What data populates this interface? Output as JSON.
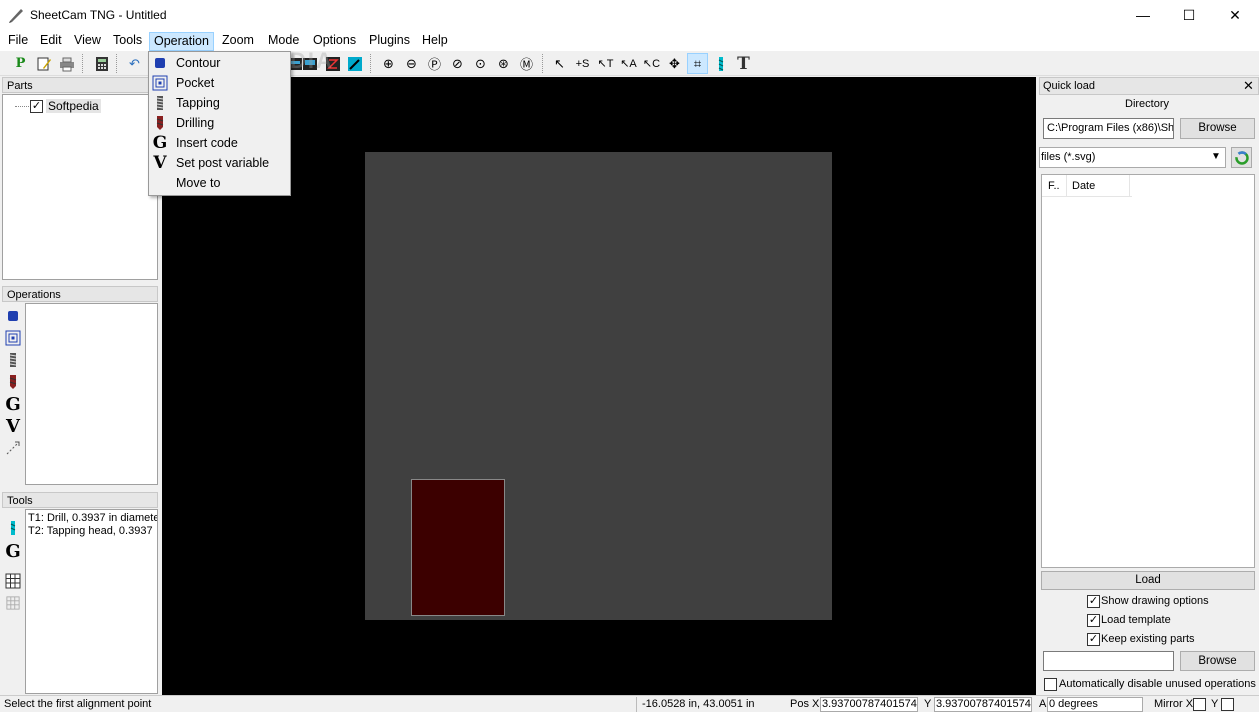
{
  "window": {
    "title": "SheetCam TNG - Untitled",
    "minimize": "—",
    "maximize": "☐",
    "close": "✕"
  },
  "menu": [
    "File",
    "Edit",
    "View",
    "Tools",
    "Operation",
    "Zoom",
    "Mode",
    "Options",
    "Plugins",
    "Help"
  ],
  "operation_menu": [
    {
      "label": "Contour",
      "icon": "contour-icon"
    },
    {
      "label": "Pocket",
      "icon": "pocket-icon"
    },
    {
      "label": "Tapping",
      "icon": "tapping-icon"
    },
    {
      "label": "Drilling",
      "icon": "drilling-icon"
    },
    {
      "label": "Insert code",
      "icon": "insert-code-icon",
      "glyph": "G"
    },
    {
      "label": "Set post variable",
      "icon": "post-variable-icon",
      "glyph": "V"
    },
    {
      "label": "Move to",
      "icon": ""
    }
  ],
  "watermark": "SOFTPEDIA",
  "parts": {
    "title": "Parts",
    "items": [
      {
        "label": "Softpedia",
        "checked": true
      }
    ]
  },
  "operations": {
    "title": "Operations",
    "glyph_g": "G",
    "glyph_v": "V"
  },
  "tools": {
    "title": "Tools",
    "items": [
      "T1: Drill, 0.3937 in diamete",
      "T2: Tapping head, 0.3937"
    ],
    "glyph_g": "G"
  },
  "quick_load": {
    "title": "Quick load",
    "directory_label": "Directory",
    "directory_value": "C:\\Program Files (x86)\\She",
    "browse": "Browse",
    "filter": "files (*.svg)",
    "columns": [
      "F..",
      "Date"
    ],
    "load": "Load",
    "options": [
      {
        "label": "Show drawing options",
        "checked": true
      },
      {
        "label": "Load template",
        "checked": true
      },
      {
        "label": "Keep existing parts",
        "checked": true
      }
    ],
    "template_browse": "Browse",
    "auto_disable": {
      "label": "Automatically disable unused operations",
      "checked": false
    }
  },
  "status": {
    "message": "Select the first alignment point",
    "coords": "-16.0528 in, 43.0051 in",
    "pos_x_label": "Pos X",
    "pos_x": "3.93700787401574",
    "y_label": "Y",
    "y": "3.93700787401574",
    "a_label": "A",
    "angle": "0 degrees",
    "mirror_x_label": "Mirror X",
    "mirror_y_label": "Y"
  },
  "colors": {
    "canvas": "#000000",
    "sheet": "#404040",
    "part": "#3c0000",
    "accent": "#cce8ff"
  }
}
